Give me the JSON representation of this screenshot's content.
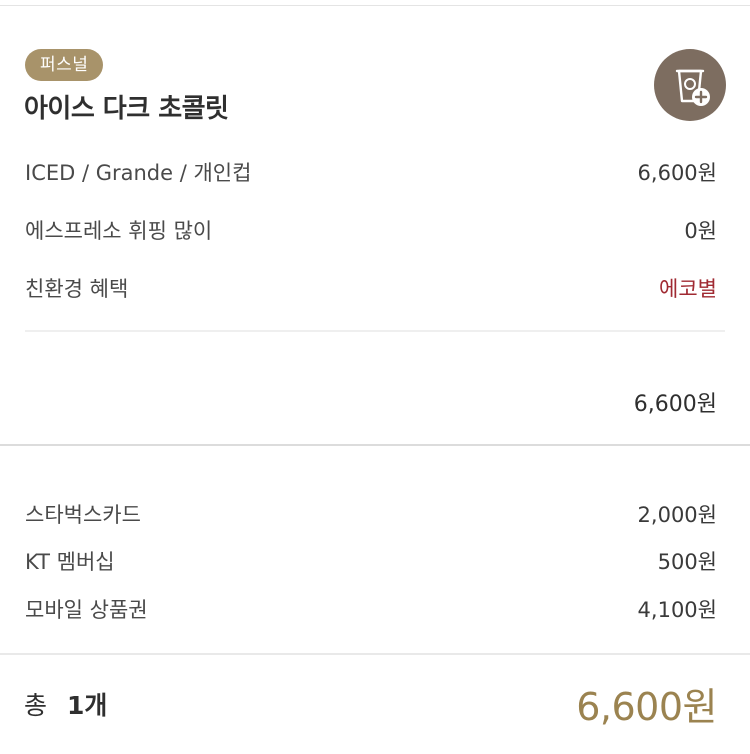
{
  "item": {
    "badge": "퍼스널",
    "name": "아이스 다크 초콜릿",
    "cup_icon": "cup-plus-icon",
    "options": [
      {
        "label": "ICED / Grande / 개인컵",
        "value": "6,600원"
      },
      {
        "label": "에스프레소 휘핑 많이",
        "value": "0원"
      },
      {
        "label": "친환경 혜택",
        "value": "에코별"
      }
    ],
    "subtotal": "6,600원"
  },
  "payments": [
    {
      "label": "스타벅스카드",
      "value": "2,000원"
    },
    {
      "label": "KT 멤버십",
      "value": "500원"
    },
    {
      "label": "모바일 상품권",
      "value": "4,100원"
    }
  ],
  "total": {
    "label": "총",
    "count": "1개",
    "price": "6,600원"
  },
  "colors": {
    "badge": "#a8936a",
    "cup_button": "#7d6d60",
    "eco_text": "#a02a32",
    "total_price": "#9b8350"
  }
}
